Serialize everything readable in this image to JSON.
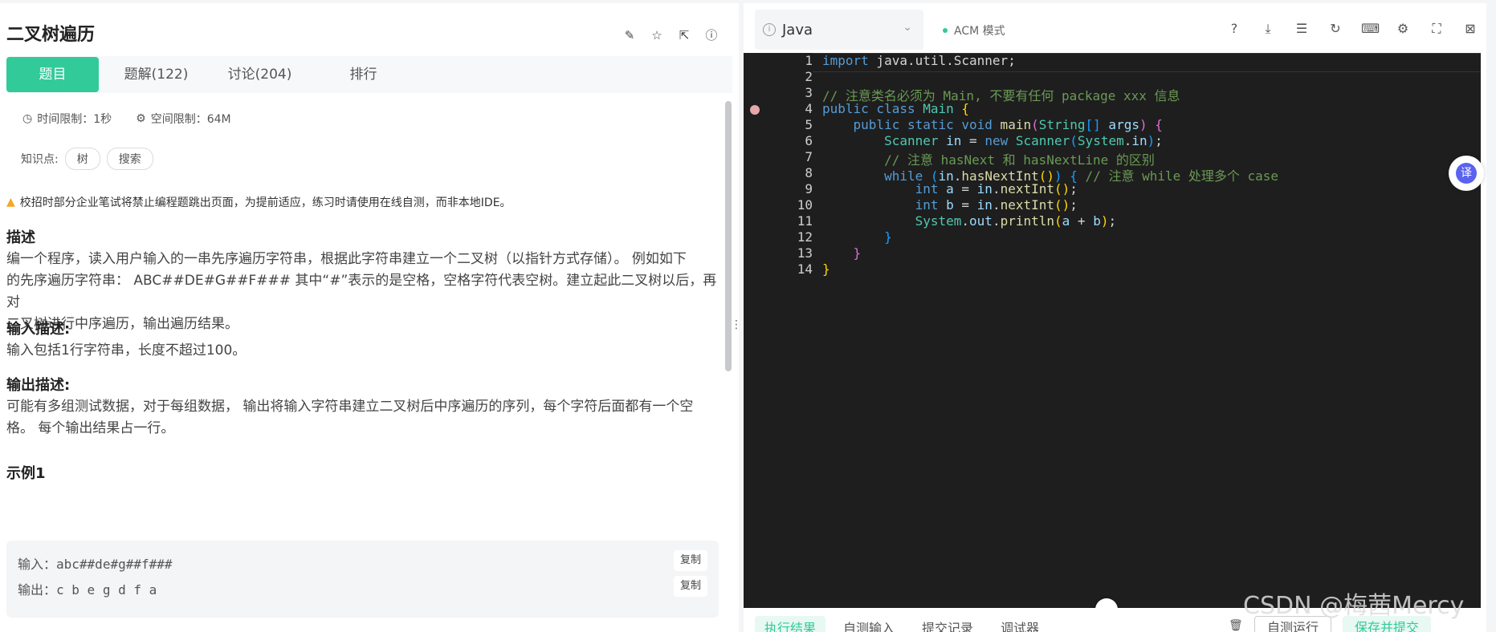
{
  "problem": {
    "title": "二叉树遍历",
    "tabs": [
      "题目",
      "题解(122)",
      "讨论(204)",
      "排行"
    ],
    "time_limit": "时间限制：1秒",
    "space_limit": "空间限制：64M",
    "knowledge_label": "知识点:",
    "tags": [
      "树",
      "搜索"
    ],
    "warning": "校招时部分企业笔试将禁止编程题跳出页面，为提前适应，练习时请使用在线自测，而非本地IDE。",
    "desc_heading": "描述",
    "desc_line1": "编一个程序，读入用户输入的一串先序遍历字符串，根据此字符串建立一个二叉树（以指针方式存储）。 例如如下",
    "desc_line2": "的先序遍历字符串： ABC##DE#G##F### 其中“#”表示的是空格，空格字符代表空树。建立起此二叉树以后，再对",
    "desc_line3": "二叉树进行中序遍历，输出遍历结果。",
    "input_heading": "输入描述:",
    "input_text": "输入包括1行字符串，长度不超过100。",
    "output_heading": "输出描述:",
    "output_line1": "可能有多组测试数据，对于每组数据， 输出将输入字符串建立二叉树后中序遍历的序列，每个字符后面都有一个空",
    "output_line2": "格。 每个输出结果占一行。",
    "example_heading": "示例1",
    "example_input_label": "输入：",
    "example_input": "abc##de#g##f###",
    "example_output_label": "输出：",
    "example_output": "c b e g d f a",
    "copy_label": "复制"
  },
  "editor": {
    "language": "Java",
    "mode": "ACM 模式",
    "line_numbers": [
      "1",
      "2",
      "3",
      "4",
      "5",
      "6",
      "7",
      "8",
      "9",
      "10",
      "11",
      "12",
      "13",
      "14"
    ],
    "code": {
      "l1_kw": "import",
      "l1_rest": " java.util.Scanner;",
      "l3": "// 注意类名必须为 Main, 不要有任何 package xxx 信息",
      "l4_kw": "public class",
      "l4_name": " Main ",
      "l4_brace": "{",
      "l5_kw": "    public static void",
      "l5_fn": " main",
      "l5_p1": "(",
      "l5_type": "String",
      "l5_arr": "[]",
      "l5_arg": " args",
      "l5_p2": ")",
      "l5_brace": " {",
      "l6_type": "        Scanner",
      "l6_var": " in",
      "l6_eq": " = ",
      "l6_kw": "new",
      "l6_type2": " Scanner",
      "l6_p1": "(",
      "l6_sys": "System",
      "l6_dot": ".",
      "l6_in": "in",
      "l6_p2": ")",
      "l6_end": ";",
      "l7": "        // 注意 hasNext 和 hasNextLine 的区别",
      "l8_kw": "        while",
      "l8_sp": " ",
      "l8_p1": "(",
      "l8_in": "in",
      "l8_dot": ".",
      "l8_fn": "hasNextInt",
      "l8_p2": "()",
      "l8_p3": ")",
      "l8_brace": " {",
      "l8_cm": " // 注意 while 处理多个 case",
      "l9_kw": "            int",
      "l9_var": " a",
      "l9_eq": " = ",
      "l9_in": "in",
      "l9_dot": ".",
      "l9_fn": "nextInt",
      "l9_p": "()",
      "l9_end": ";",
      "l10_kw": "            int",
      "l10_var": " b",
      "l10_eq": " = ",
      "l10_in": "in",
      "l10_dot": ".",
      "l10_fn": "nextInt",
      "l10_p": "()",
      "l10_end": ";",
      "l11_sys": "            System",
      "l11_dot1": ".",
      "l11_out": "out",
      "l11_dot2": ".",
      "l11_fn": "println",
      "l11_p1": "(",
      "l11_a": "a",
      "l11_plus": " + ",
      "l11_b": "b",
      "l11_p2": ")",
      "l11_end": ";",
      "l12": "        }",
      "l13": "    }",
      "l14": "}"
    },
    "translate_label": "译",
    "bottom_tabs": [
      "执行结果",
      "自测输入",
      "提交记录",
      "调试器"
    ],
    "run_label": "自测运行",
    "submit_label": "保存并提交"
  },
  "watermark": "CSDN @梅茜Mercy"
}
